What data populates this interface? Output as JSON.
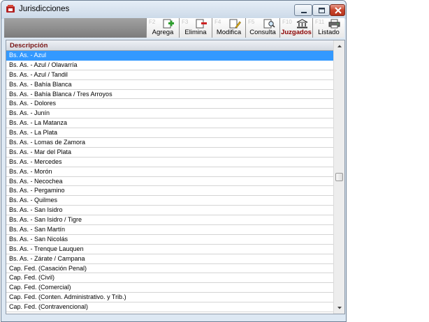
{
  "window": {
    "title": "Jurisdicciones"
  },
  "toolbar": {
    "buttons": [
      {
        "fkey": "F2",
        "label": "Agrega",
        "icon": "add-record-icon",
        "active": false
      },
      {
        "fkey": "F3",
        "label": "Elimina",
        "icon": "delete-record-icon",
        "active": false
      },
      {
        "fkey": "F4",
        "label": "Modifica",
        "icon": "edit-record-icon",
        "active": false
      },
      {
        "fkey": "F5",
        "label": "Consulta",
        "icon": "view-record-icon",
        "active": false
      },
      {
        "fkey": "F10",
        "label": "Juzgados",
        "icon": "courthouse-icon",
        "active": true
      },
      {
        "fkey": "F11",
        "label": "Listado",
        "icon": "print-list-icon",
        "active": false
      }
    ]
  },
  "grid": {
    "column_header": "Descripción",
    "selected_row": 0,
    "rows": [
      "Bs. As. - Azul",
      "Bs. As. - Azul / Olavarría",
      "Bs. As. - Azul / Tandil",
      "Bs. As. - Bahía Blanca",
      "Bs. As. - Bahía Blanca / Tres Arroyos",
      "Bs. As. - Dolores",
      "Bs. As. - Junín",
      "Bs. As. - La Matanza",
      "Bs. As. - La Plata",
      "Bs. As. - Lomas de Zamora",
      "Bs. As. - Mar del Plata",
      "Bs. As. - Mercedes",
      "Bs. As. - Morón",
      "Bs. As. - Necochea",
      "Bs. As. - Pergamino",
      "Bs. As. - Quilmes",
      "Bs. As. - San Isidro",
      "Bs. As. - San Isidro / Tigre",
      "Bs. As. - San Martín",
      "Bs. As. - San Nicolás",
      "Bs. As. - Trenque Lauquen",
      "Bs. As. - Zárate / Campana",
      "Cap. Fed. (Casación Penal)",
      "Cap. Fed. (Civil)",
      "Cap. Fed. (Comercial)",
      "Cap. Fed. (Conten. Administrativo. y Trib.)",
      "Cap. Fed. (Contravencional)"
    ]
  },
  "colors": {
    "selection": "#3399ff",
    "header_text": "#7a1414",
    "active_tool_text": "#8b0000"
  }
}
